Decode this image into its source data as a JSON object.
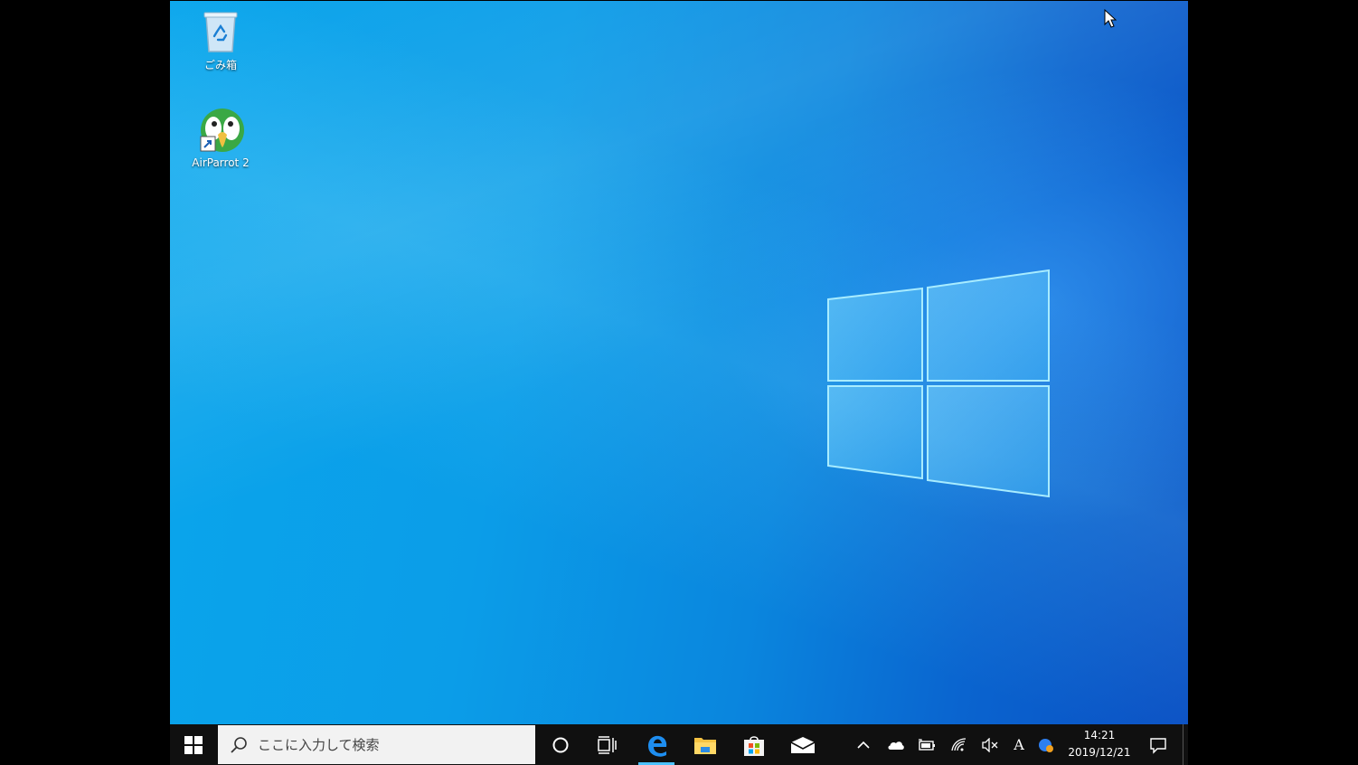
{
  "desktop": {
    "icons": [
      {
        "label": "ごみ箱",
        "icon": "recycle-bin-icon"
      },
      {
        "label": "AirParrot 2",
        "icon": "airparrot-icon"
      }
    ]
  },
  "taskbar": {
    "start_icon": "windows-start-icon",
    "search_placeholder": "ここに入力して検索",
    "pinned": [
      "cortana-icon",
      "task-view-icon",
      "edge-icon",
      "file-explorer-icon",
      "store-icon",
      "mail-icon"
    ],
    "active_app": "edge-icon",
    "tray": {
      "icons": [
        "chevron-up-icon",
        "onedrive-icon",
        "battery-icon",
        "wifi-icon",
        "volume-muted-icon",
        "ime-icon",
        "app-tray-icon"
      ],
      "ime_label": "A",
      "time": "14:21",
      "date": "2019/12/21"
    },
    "notification_icon": "notification-icon"
  },
  "colors": {
    "desktop_blue": "#0a9de8",
    "taskbar": "#101010",
    "accent": "#4cc2ff"
  }
}
